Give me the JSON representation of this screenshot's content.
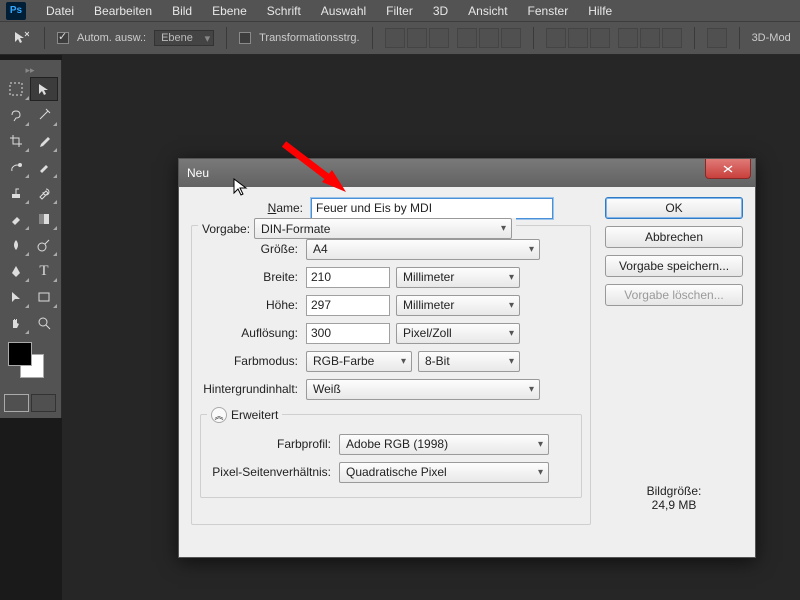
{
  "app": {
    "logo": "Ps"
  },
  "menu": [
    "Datei",
    "Bearbeiten",
    "Bild",
    "Ebene",
    "Schrift",
    "Auswahl",
    "Filter",
    "3D",
    "Ansicht",
    "Fenster",
    "Hilfe"
  ],
  "optbar": {
    "auto_select": "Autom. ausw.:",
    "auto_select_mode": "Ebene",
    "transform_controls": "Transformationsstrg.",
    "mode3d": "3D-Mod"
  },
  "dialog": {
    "title": "Neu",
    "name_label": "Name:",
    "name_value": "Feuer und Eis by MDI",
    "preset_label": "Vorgabe:",
    "preset_value": "DIN-Formate",
    "size_label": "Größe:",
    "size_value": "A4",
    "width_label": "Breite:",
    "width_value": "210",
    "width_unit": "Millimeter",
    "height_label": "Höhe:",
    "height_value": "297",
    "height_unit": "Millimeter",
    "resolution_label": "Auflösung:",
    "resolution_value": "300",
    "resolution_unit": "Pixel/Zoll",
    "colormode_label": "Farbmodus:",
    "colormode_value": "RGB-Farbe",
    "colormode_depth": "8-Bit",
    "bgcontent_label": "Hintergrundinhalt:",
    "bgcontent_value": "Weiß",
    "advanced_label": "Erweitert",
    "colorprofile_label": "Farbprofil:",
    "colorprofile_value": "Adobe RGB (1998)",
    "pixelaspect_label": "Pixel-Seitenverhältnis:",
    "pixelaspect_value": "Quadratische Pixel",
    "buttons": {
      "ok": "OK",
      "cancel": "Abbrechen",
      "save_preset": "Vorgabe speichern...",
      "delete_preset": "Vorgabe löschen..."
    },
    "imagesize_label": "Bildgröße:",
    "imagesize_value": "24,9 MB"
  }
}
